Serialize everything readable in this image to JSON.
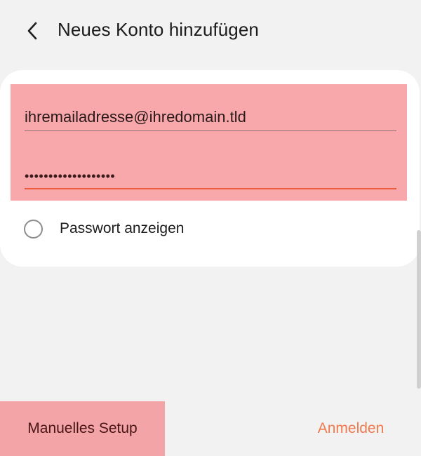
{
  "header": {
    "back_icon": "chevron-left-icon",
    "title": "Neues Konto hinzufügen"
  },
  "form": {
    "email_value": "ihremailadresse@ihredomain.tld",
    "password_mask": "•••••••••••••••••••",
    "show_password_label": "Passwort anzeigen",
    "show_password_checked": false
  },
  "footer": {
    "manual_setup_label": "Manuelles Setup",
    "login_label": "Anmelden"
  },
  "colors": {
    "accent": "#f07a4e",
    "focus_underline": "#ee5a3a",
    "highlight": "#f8a7ab",
    "background": "#f2f2f2"
  }
}
